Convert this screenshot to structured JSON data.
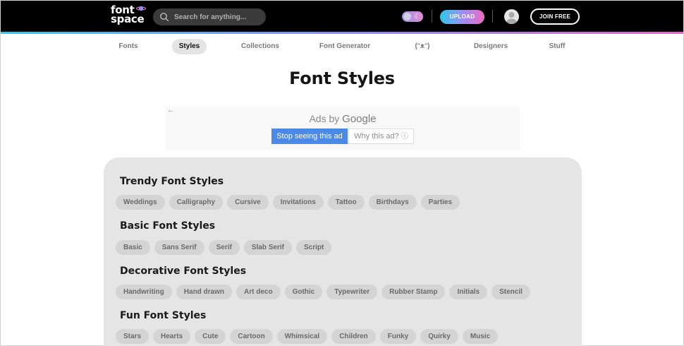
{
  "header": {
    "logo": {
      "line1": "font",
      "line2": "space"
    },
    "search": {
      "placeholder": "Search for anything..."
    },
    "upload_label": "UPLOAD",
    "join_label": "JOIN FREE"
  },
  "nav": {
    "items": [
      {
        "label": "Fonts"
      },
      {
        "label": "Styles"
      },
      {
        "label": "Collections"
      },
      {
        "label": "Font Generator"
      },
      {
        "label": "(ᵔᴥᵔ)"
      },
      {
        "label": "Designers"
      },
      {
        "label": "Stuff"
      }
    ],
    "active": "Styles"
  },
  "page": {
    "title": "Font Styles"
  },
  "ad": {
    "back": "←",
    "ads_by": "Ads by",
    "google": "Google",
    "stop_label": "Stop seeing this ad",
    "why_label": "Why this ad?",
    "why_icon": "ⓘ"
  },
  "sections": [
    {
      "title": "Trendy Font Styles",
      "chips": [
        "Weddings",
        "Calligraphy",
        "Cursive",
        "Invitations",
        "Tattoo",
        "Birthdays",
        "Parties"
      ]
    },
    {
      "title": "Basic Font Styles",
      "chips": [
        "Basic",
        "Sans Serif",
        "Serif",
        "Slab Serif",
        "Script"
      ]
    },
    {
      "title": "Decorative Font Styles",
      "chips": [
        "Handwriting",
        "Hand drawn",
        "Art deco",
        "Gothic",
        "Typewriter",
        "Rubber Stamp",
        "Initials",
        "Stencil"
      ]
    },
    {
      "title": "Fun Font Styles",
      "chips": [
        "Stars",
        "Hearts",
        "Cute",
        "Cartoon",
        "Whimsical",
        "Children",
        "Funky",
        "Quirky",
        "Music"
      ]
    }
  ],
  "colors": {
    "header_bg": "#000000",
    "accent_gradient": [
      "#35c8ea",
      "#8a8ff0",
      "#e467c7"
    ],
    "panel_bg": "#e5e5e5",
    "chip_bg": "#d4d4d4",
    "ad_button": "#4a89e8"
  }
}
